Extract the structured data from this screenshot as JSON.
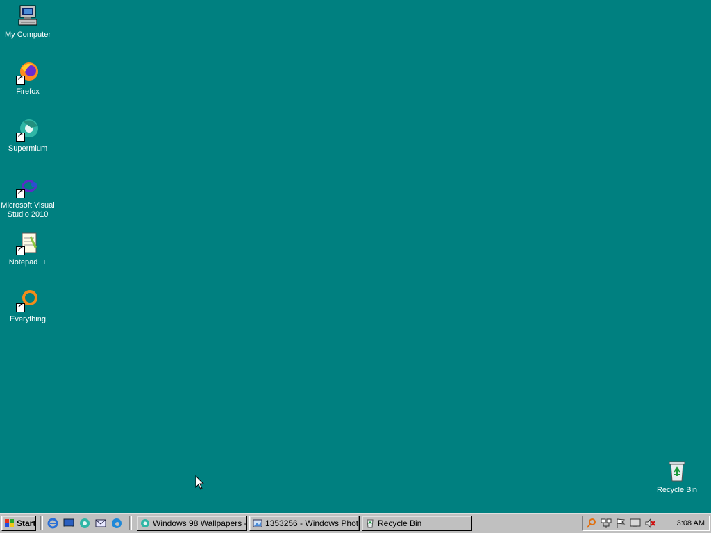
{
  "desktop": {
    "background_color": "#008080",
    "icons": [
      {
        "label": "My Computer",
        "icon": "my-computer-icon"
      },
      {
        "label": "Firefox",
        "icon": "firefox-icon"
      },
      {
        "label": "Supermium",
        "icon": "supermium-icon"
      },
      {
        "label": "Microsoft Visual Studio 2010",
        "icon": "visual-studio-icon"
      },
      {
        "label": "Notepad++",
        "icon": "notepad-plus-plus-icon"
      },
      {
        "label": "Everything",
        "icon": "everything-search-icon"
      },
      {
        "label": "Recycle Bin",
        "icon": "recycle-bin-icon"
      }
    ]
  },
  "taskbar": {
    "start_label": "Start",
    "quick_launch": [
      {
        "icon": "internet-explorer-icon"
      },
      {
        "icon": "show-desktop-icon"
      },
      {
        "icon": "supermium-icon"
      },
      {
        "icon": "outlook-express-icon"
      },
      {
        "icon": "edge-icon"
      }
    ],
    "tasks": [
      {
        "label": "Windows 98 Wallpapers -...",
        "icon": "supermium-icon"
      },
      {
        "label": "1353256 - Windows Phot...",
        "icon": "photo-viewer-icon"
      },
      {
        "label": "Recycle Bin",
        "icon": "recycle-bin-icon"
      }
    ],
    "tray": {
      "icons": [
        "search-icon",
        "network-icon",
        "flag-icon",
        "display-icon",
        "volume-muted-icon"
      ],
      "clock": "3:08 AM"
    }
  }
}
